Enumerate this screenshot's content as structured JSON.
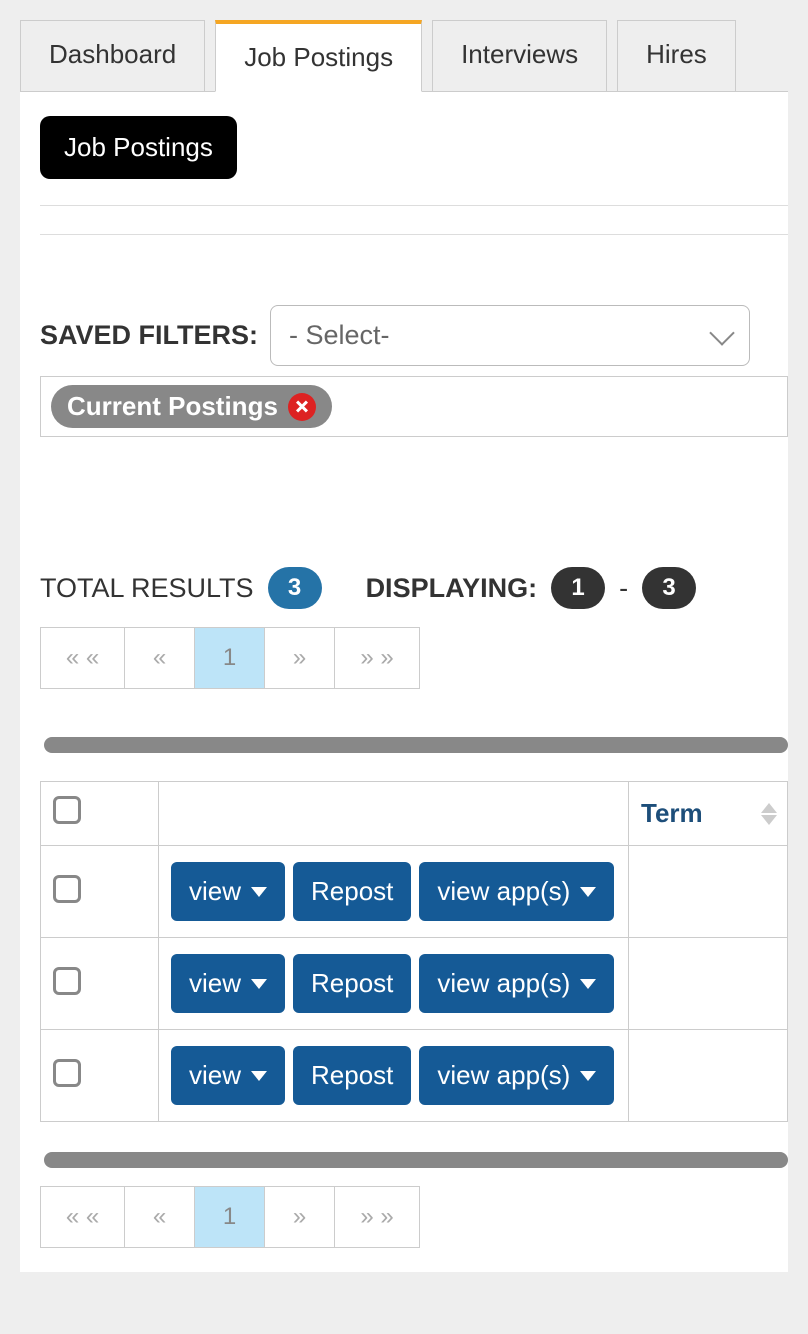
{
  "tabs": {
    "dashboard": "Dashboard",
    "job_postings": "Job Postings",
    "interviews": "Interviews",
    "hires": "Hires"
  },
  "heading_button": "Job Postings",
  "filters": {
    "label": "SAVED FILTERS:",
    "select_placeholder": "- Select-",
    "chip": "Current Postings"
  },
  "results": {
    "total_label": "TOTAL RESULTS",
    "total": "3",
    "displaying_label": "DISPLAYING:",
    "from": "1",
    "dash": "-",
    "to": "3"
  },
  "pager": {
    "first": "« «",
    "prev": "«",
    "page": "1",
    "next": "»",
    "last": "» »"
  },
  "table": {
    "headers": {
      "term": "Term"
    },
    "actions": {
      "view": "view",
      "repost": "Repost",
      "view_apps": "view app(s)"
    },
    "rows": [
      {
        "term": ""
      },
      {
        "term": ""
      },
      {
        "term": ""
      }
    ]
  }
}
